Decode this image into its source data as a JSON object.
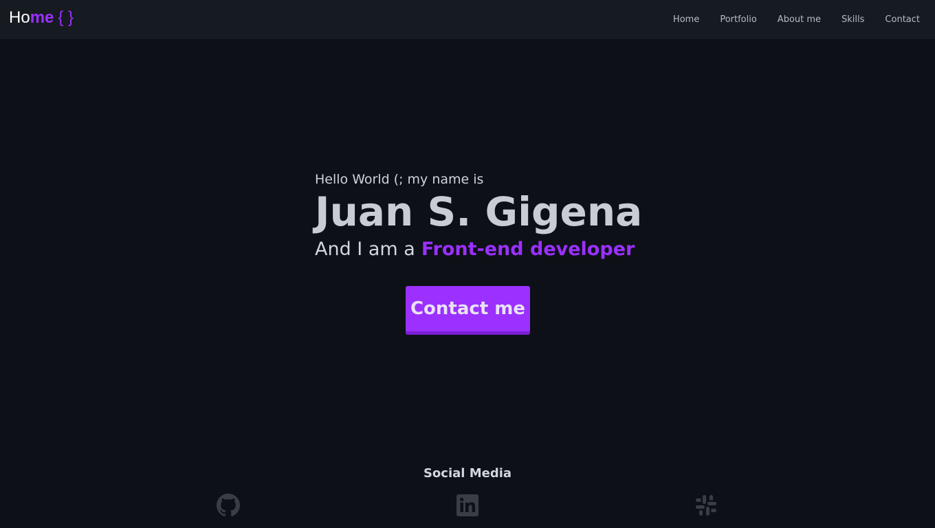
{
  "header": {
    "logo": {
      "part1": "Ho",
      "part2": "me",
      "braces": "{ }"
    },
    "nav": [
      "Home",
      "Portfolio",
      "About me",
      "Skills",
      "Contact"
    ]
  },
  "hero": {
    "greeting": "Hello World (; my name is",
    "name": "Juan S. Gigena",
    "role_prefix": "And I am a",
    "role": "Front-end developer",
    "cta_label": "Contact me"
  },
  "social": {
    "title": "Social Media",
    "icons": [
      "github-icon",
      "linkedin-icon",
      "slack-icon"
    ]
  },
  "colors": {
    "background": "#0d1017",
    "navbar": "#161a21",
    "accent": "#9b30ff",
    "icon": "#3a3d44"
  }
}
